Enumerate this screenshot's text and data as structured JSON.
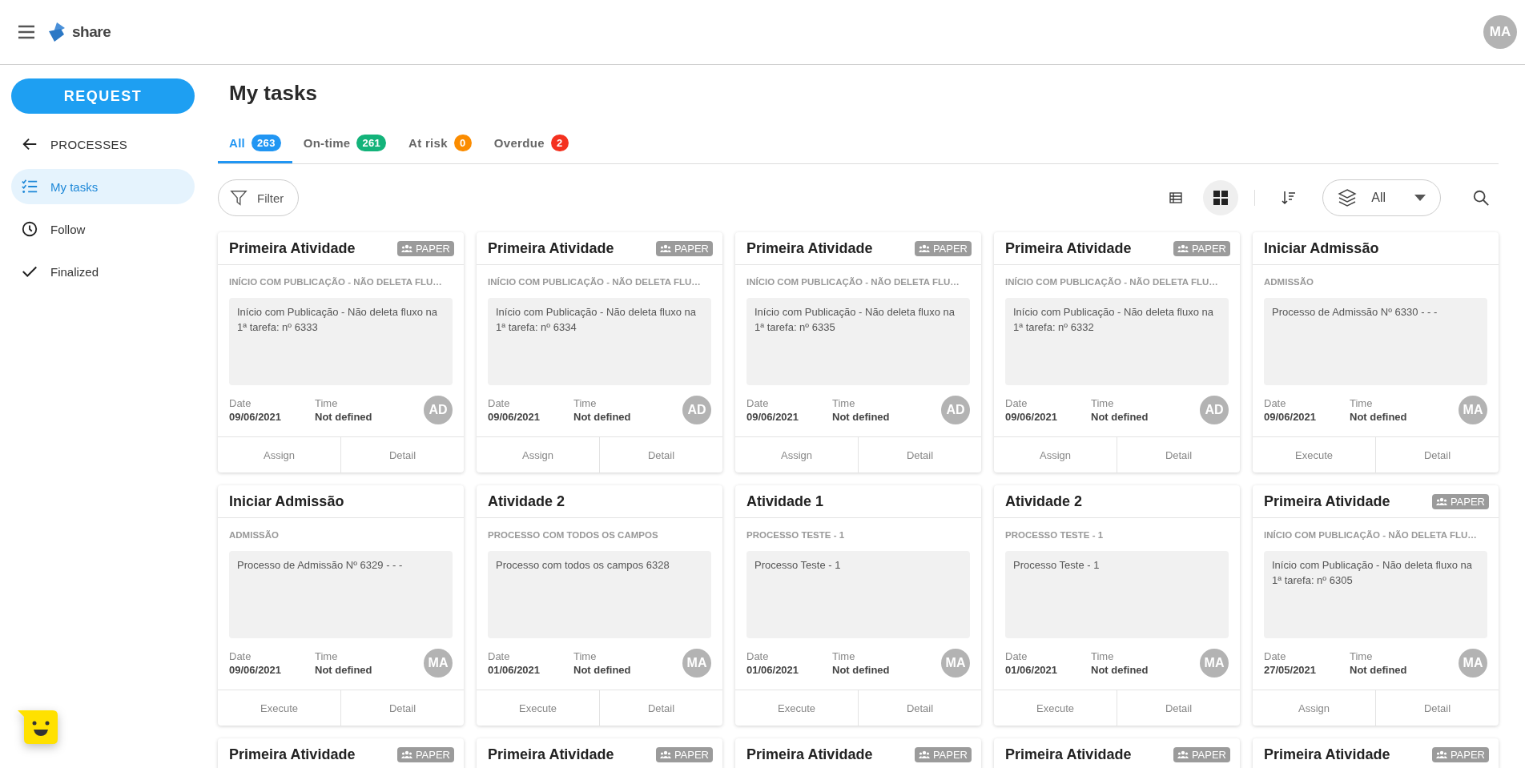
{
  "header": {
    "brand": "share",
    "avatar": "MA"
  },
  "sidebar": {
    "request": "REQUEST",
    "back": "PROCESSES",
    "items": [
      {
        "label": "My tasks",
        "selected": true
      },
      {
        "label": "Follow",
        "selected": false
      },
      {
        "label": "Finalized",
        "selected": false
      }
    ]
  },
  "page": {
    "title": "My tasks"
  },
  "tabs": [
    {
      "label": "All",
      "count": "263",
      "color": "#2196f3",
      "selected": true
    },
    {
      "label": "On-time",
      "count": "261",
      "color": "#13b37a",
      "selected": false
    },
    {
      "label": "At risk",
      "count": "0",
      "color": "#fb8c00",
      "selected": false
    },
    {
      "label": "Overdue",
      "count": "2",
      "color": "#f4311f",
      "selected": false
    }
  ],
  "toolbar": {
    "filter": "Filter",
    "views": [
      {
        "kind": "table",
        "selected": false
      },
      {
        "kind": "grid",
        "selected": true
      }
    ],
    "layer_filter": "All"
  },
  "cards": [
    {
      "title": "Primeira Atividade",
      "badge": "PAPER",
      "process": "INÍCIO COM PUBLICAÇÃO - NÃO DELETA FLU…",
      "description": "Início com Publicação - Não deleta fluxo na 1ª tarefa: nº 6333",
      "date_label": "Date",
      "date": "09/06/2021",
      "time_label": "Time",
      "time": "Not defined",
      "assignee": "AD",
      "actions": [
        "Assign",
        "Detail"
      ]
    },
    {
      "title": "Primeira Atividade",
      "badge": "PAPER",
      "process": "INÍCIO COM PUBLICAÇÃO - NÃO DELETA FLU…",
      "description": "Início com Publicação - Não deleta fluxo na 1ª tarefa: nº 6334",
      "date_label": "Date",
      "date": "09/06/2021",
      "time_label": "Time",
      "time": "Not defined",
      "assignee": "AD",
      "actions": [
        "Assign",
        "Detail"
      ]
    },
    {
      "title": "Primeira Atividade",
      "badge": "PAPER",
      "process": "INÍCIO COM PUBLICAÇÃO - NÃO DELETA FLU…",
      "description": "Início com Publicação - Não deleta fluxo na 1ª tarefa: nº 6335",
      "date_label": "Date",
      "date": "09/06/2021",
      "time_label": "Time",
      "time": "Not defined",
      "assignee": "AD",
      "actions": [
        "Assign",
        "Detail"
      ]
    },
    {
      "title": "Primeira Atividade",
      "badge": "PAPER",
      "process": "INÍCIO COM PUBLICAÇÃO - NÃO DELETA FLU…",
      "description": "Início com Publicação - Não deleta fluxo na 1ª tarefa: nº 6332",
      "date_label": "Date",
      "date": "09/06/2021",
      "time_label": "Time",
      "time": "Not defined",
      "assignee": "AD",
      "actions": [
        "Assign",
        "Detail"
      ]
    },
    {
      "title": "Iniciar Admissão",
      "process": "ADMISSÃO",
      "description": "Processo de Admissão Nº 6330 - - -",
      "date_label": "Date",
      "date": "09/06/2021",
      "time_label": "Time",
      "time": "Not defined",
      "assignee": "MA",
      "actions": [
        "Execute",
        "Detail"
      ]
    },
    {
      "title": "Iniciar Admissão",
      "process": "ADMISSÃO",
      "description": "Processo de Admissão Nº 6329 - - -",
      "date_label": "Date",
      "date": "09/06/2021",
      "time_label": "Time",
      "time": "Not defined",
      "assignee": "MA",
      "actions": [
        "Execute",
        "Detail"
      ]
    },
    {
      "title": "Atividade 2",
      "process": "PROCESSO COM TODOS OS CAMPOS",
      "description": "Processo com todos os campos 6328",
      "date_label": "Date",
      "date": "01/06/2021",
      "time_label": "Time",
      "time": "Not defined",
      "assignee": "MA",
      "actions": [
        "Execute",
        "Detail"
      ]
    },
    {
      "title": "Atividade 1",
      "process": "PROCESSO TESTE - 1",
      "description": "Processo Teste - 1",
      "date_label": "Date",
      "date": "01/06/2021",
      "time_label": "Time",
      "time": "Not defined",
      "assignee": "MA",
      "actions": [
        "Execute",
        "Detail"
      ]
    },
    {
      "title": "Atividade 2",
      "process": "PROCESSO TESTE - 1",
      "description": "Processo Teste - 1",
      "date_label": "Date",
      "date": "01/06/2021",
      "time_label": "Time",
      "time": "Not defined",
      "assignee": "MA",
      "actions": [
        "Execute",
        "Detail"
      ]
    },
    {
      "title": "Primeira Atividade",
      "badge": "PAPER",
      "process": "INÍCIO COM PUBLICAÇÃO - NÃO DELETA FLU…",
      "description": "Início com Publicação - Não deleta fluxo na 1ª tarefa: nº 6305",
      "date_label": "Date",
      "date": "27/05/2021",
      "time_label": "Time",
      "time": "Not defined",
      "assignee": "MA",
      "actions": [
        "Assign",
        "Detail"
      ]
    },
    {
      "title": "Primeira Atividade",
      "badge": "PAPER"
    },
    {
      "title": "Primeira Atividade",
      "badge": "PAPER"
    },
    {
      "title": "Primeira Atividade",
      "badge": "PAPER"
    },
    {
      "title": "Primeira Atividade",
      "badge": "PAPER"
    },
    {
      "title": "Primeira Atividade",
      "badge": "PAPER"
    }
  ]
}
